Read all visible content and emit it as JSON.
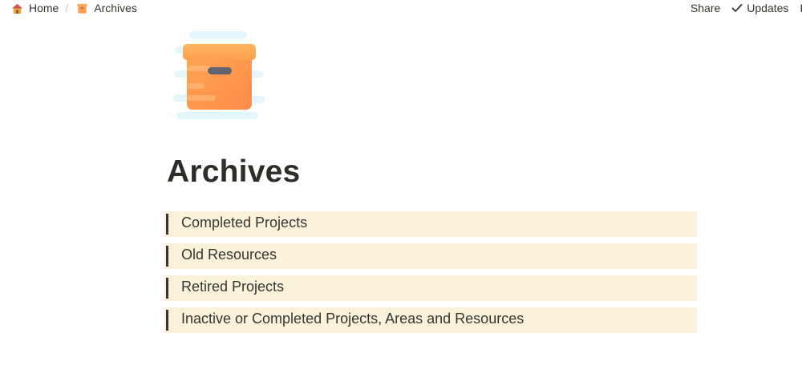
{
  "breadcrumb": {
    "items": [
      {
        "label": "Home",
        "icon": "house-icon"
      },
      {
        "label": "Archives",
        "icon": "archive-box-icon"
      }
    ],
    "separator": "/"
  },
  "actions": {
    "share_label": "Share",
    "updates_label": "Updates",
    "truncated_label": "F"
  },
  "page": {
    "icon": "archive-box-icon",
    "title": "Archives"
  },
  "callouts": [
    {
      "text": "Completed Projects"
    },
    {
      "text": "Old Resources"
    },
    {
      "text": "Retired Projects"
    },
    {
      "text": "Inactive or Completed Projects, Areas and Resources"
    }
  ],
  "colors": {
    "callout_bg": "#fbf2dc",
    "callout_bar": "#37352f",
    "text": "#37352f",
    "box_orange": "#ff9d4f",
    "box_lid": "#ffab5a"
  }
}
